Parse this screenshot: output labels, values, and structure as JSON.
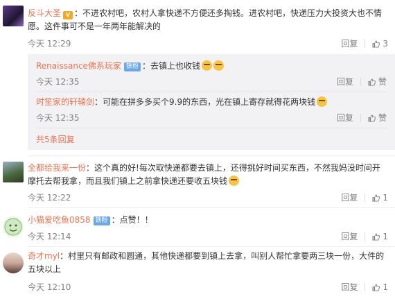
{
  "labels": {
    "reply": "回复",
    "like": "赞",
    "fan_badge": "铁粉"
  },
  "comments": [
    {
      "user": "反斗大圣",
      "text": "：不进农村吧，农村人拿快递不方便还多掏钱。进农村吧，快递压力大投资大也不情愿。这件事可不是一年两年能解决的",
      "time": "今天 12:29",
      "likes": "3",
      "replies": [
        {
          "user": "Renaissance佛系玩家",
          "text": "：去镇上也收钱",
          "time": "今天 12:35"
        },
        {
          "user": "时笙家的轩辕剑",
          "text": "：可能在拼多多买个9.9的东西，光在镇上寄存就得花两块钱",
          "time": "今天 12:35"
        }
      ],
      "more_replies": "共5条回复"
    },
    {
      "user": "全都给我来一份",
      "text": "：这个真的好!每次取快递都要去镇上，还得挑好时间买东西，不然我妈没时间开摩托去帮我拿，而且我们镇上之前拿快递还要收五块钱",
      "time": "今天 12:22",
      "likes": "1"
    },
    {
      "user": "小猫爱吃鱼0858",
      "text": "：点赞！！",
      "time": "今天 12:14",
      "likes": "1"
    },
    {
      "user": "奇才myl",
      "text": "：村里只有邮政和圆通，其他快递都要到镇上去拿，叫别人帮忙拿要两三块一份，大件的五块以上",
      "time": "今天 12:10",
      "likes": "1"
    }
  ]
}
